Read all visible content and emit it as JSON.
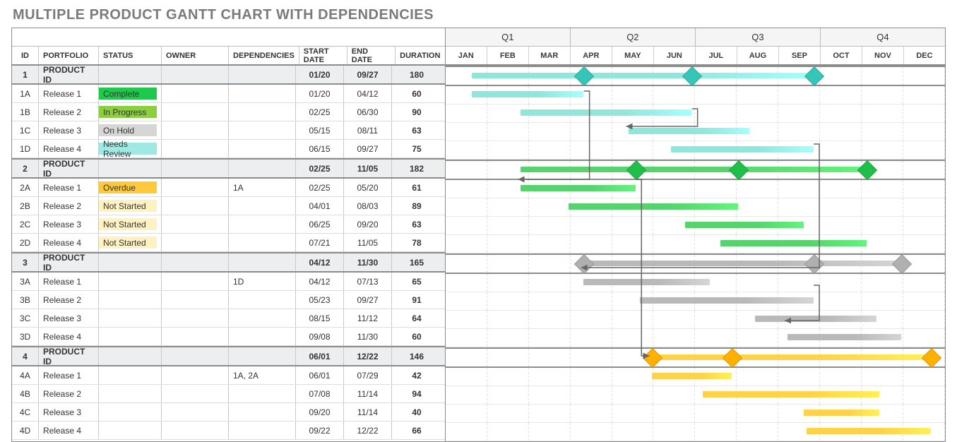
{
  "title": "MULTIPLE PRODUCT GANTT CHART WITH DEPENDENCIES",
  "columns": {
    "id": "ID",
    "portfolio": "PORTFOLIO",
    "status": "STATUS",
    "owner": "OWNER",
    "dependencies": "DEPENDENCIES",
    "start": "START DATE",
    "end": "END DATE",
    "duration": "DURATION"
  },
  "quarters": [
    "Q1",
    "Q2",
    "Q3",
    "Q4"
  ],
  "months": [
    "JAN",
    "FEB",
    "MAR",
    "APR",
    "MAY",
    "JUN",
    "JUL",
    "AUG",
    "AUG",
    "SEP",
    "OCT",
    "NOV",
    "DEC"
  ],
  "months_correct": [
    "JAN",
    "FEB",
    "MAR",
    "APR",
    "MAY",
    "JUN",
    "JUL",
    "AUG",
    "SEP",
    "OCT",
    "NOV",
    "DEC"
  ],
  "status_colors": {
    "Complete": "#1ec94b",
    "In Progress": "#8bcf3e",
    "On Hold": "#d6d6d6",
    "Needs Review": "#9fe8e3",
    "Overdue": "#ffc93a",
    "Not Started": "#fff2c2"
  },
  "group_colors": {
    "1": {
      "bar": "#8fe6db",
      "diamond": "#36c6b8"
    },
    "2": {
      "bar": "#57d36d",
      "diamond": "#1fbf4a"
    },
    "3": {
      "bar": "#b9b9b9",
      "diamond": "#b0b0b0"
    },
    "4": {
      "bar": "#ffd24a",
      "diamond": "#ffb000"
    }
  },
  "chart_data": {
    "type": "gantt",
    "x_axis": {
      "start": "01/01",
      "end": "12/31"
    },
    "rows": [
      {
        "id": "1",
        "portfolio": "PRODUCT ID",
        "group": true,
        "start": "01/20",
        "end": "09/27",
        "duration": 180,
        "milestones": [
          "04/12",
          "06/30",
          "09/27"
        ]
      },
      {
        "id": "1A",
        "portfolio": "Release 1",
        "status": "Complete",
        "start": "01/20",
        "end": "04/12",
        "duration": 60
      },
      {
        "id": "1B",
        "portfolio": "Release 2",
        "status": "In Progress",
        "start": "02/25",
        "end": "06/30",
        "duration": 90
      },
      {
        "id": "1C",
        "portfolio": "Release 3",
        "status": "On Hold",
        "start": "05/15",
        "end": "08/11",
        "duration": 63
      },
      {
        "id": "1D",
        "portfolio": "Release 4",
        "status": "Needs Review",
        "start": "06/15",
        "end": "09/27",
        "duration": 75
      },
      {
        "id": "2",
        "portfolio": "PRODUCT ID",
        "group": true,
        "start": "02/25",
        "end": "11/05",
        "duration": 182,
        "milestones": [
          "05/20",
          "08/03",
          "11/05"
        ]
      },
      {
        "id": "2A",
        "portfolio": "Release 1",
        "status": "Overdue",
        "dependencies": "1A",
        "start": "02/25",
        "end": "05/20",
        "duration": 61
      },
      {
        "id": "2B",
        "portfolio": "Release 2",
        "status": "Not Started",
        "start": "04/01",
        "end": "08/03",
        "duration": 89
      },
      {
        "id": "2C",
        "portfolio": "Release 3",
        "status": "Not Started",
        "start": "06/25",
        "end": "09/20",
        "duration": 63
      },
      {
        "id": "2D",
        "portfolio": "Release 4",
        "status": "Not Started",
        "start": "07/21",
        "end": "11/05",
        "duration": 78
      },
      {
        "id": "3",
        "portfolio": "PRODUCT ID",
        "group": true,
        "start": "04/12",
        "end": "11/30",
        "duration": 165,
        "milestones": [
          "04/12",
          "09/27",
          "11/30"
        ]
      },
      {
        "id": "3A",
        "portfolio": "Release 1",
        "dependencies": "1D",
        "start": "04/12",
        "end": "07/13",
        "duration": 65
      },
      {
        "id": "3B",
        "portfolio": "Release 2",
        "start": "05/23",
        "end": "09/27",
        "duration": 91
      },
      {
        "id": "3C",
        "portfolio": "Release 3",
        "start": "08/15",
        "end": "11/12",
        "duration": 64
      },
      {
        "id": "3D",
        "portfolio": "Release 4",
        "start": "09/08",
        "end": "11/30",
        "duration": 60
      },
      {
        "id": "4",
        "portfolio": "PRODUCT ID",
        "group": true,
        "start": "06/01",
        "end": "12/22",
        "duration": 146,
        "milestones": [
          "06/01",
          "07/29",
          "12/22"
        ]
      },
      {
        "id": "4A",
        "portfolio": "Release 1",
        "dependencies": "1A, 2A",
        "start": "06/01",
        "end": "07/29",
        "duration": 42
      },
      {
        "id": "4B",
        "portfolio": "Release 2",
        "start": "07/08",
        "end": "11/14",
        "duration": 94
      },
      {
        "id": "4C",
        "portfolio": "Release 3",
        "start": "09/20",
        "end": "11/14",
        "duration": 40
      },
      {
        "id": "4D",
        "portfolio": "Release 4",
        "start": "09/22",
        "end": "12/22",
        "duration": 66
      }
    ],
    "dependencies": [
      {
        "from": "1A",
        "to": "2A"
      },
      {
        "from": "1B",
        "to": "1C"
      },
      {
        "from": "1D",
        "to": "3A"
      },
      {
        "from": "2A",
        "to": "4A"
      },
      {
        "from": "3B",
        "to": "3D"
      }
    ]
  }
}
